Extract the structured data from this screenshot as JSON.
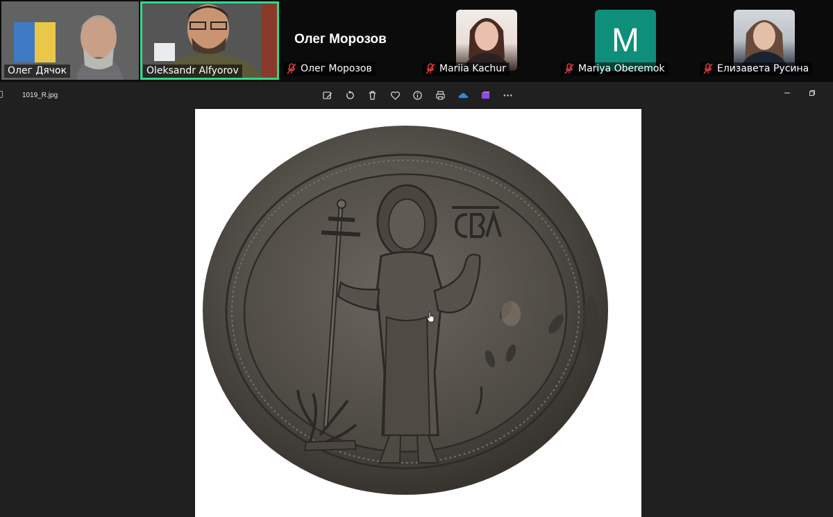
{
  "participants": [
    {
      "name": "Олег Дячок",
      "muted": false,
      "video": true
    },
    {
      "name": "Oleksandr Alfyorov",
      "muted": false,
      "video": true,
      "active_speaker": true
    },
    {
      "name": "Олег Морозов",
      "muted": true,
      "video": false
    },
    {
      "name": "Mariia Kachur",
      "muted": true,
      "video": false
    },
    {
      "name": "Mariya Oberemok",
      "muted": true,
      "video": false,
      "avatar_letter": "M"
    },
    {
      "name": "Елизавета Русина",
      "muted": true,
      "video": false
    }
  ],
  "featured_name": "Олег Морозов",
  "viewer": {
    "filename": "1019_R.jpg",
    "toolbar": [
      "edit-icon",
      "rotate-icon",
      "delete-icon",
      "favorite-icon",
      "info-icon",
      "print-icon",
      "onedrive-icon",
      "clipchamp-icon",
      "more-icon"
    ]
  },
  "colors": {
    "active_border": "#2fd98a",
    "avatar_m": "#0e8f7b",
    "mute_red": "#e0393e"
  }
}
